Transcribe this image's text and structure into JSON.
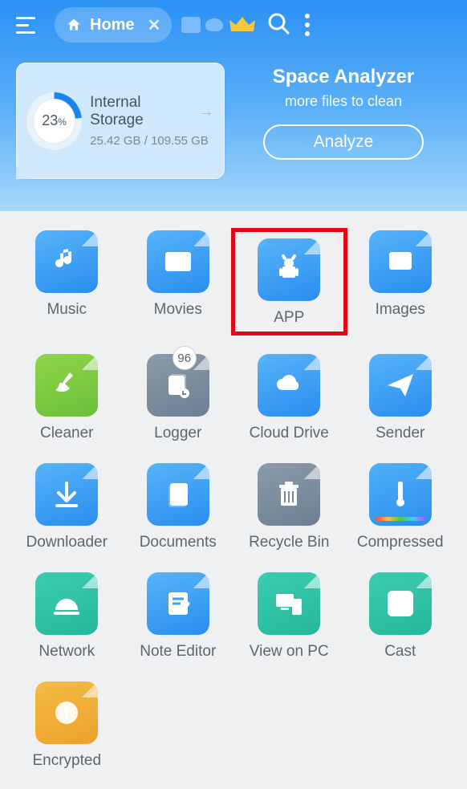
{
  "header": {
    "tab_label": "Home",
    "analyzer_title": "Space Analyzer",
    "analyzer_sub": "more files to clean",
    "analyze_btn": "Analyze"
  },
  "storage": {
    "title": "Internal Storage",
    "used": "25.42 GB",
    "total": "109.55 GB",
    "percent": 23,
    "percent_label": "23",
    "percent_unit": "%"
  },
  "grid": [
    {
      "id": "music",
      "label": "Music",
      "theme": "blue"
    },
    {
      "id": "movies",
      "label": "Movies",
      "theme": "blue"
    },
    {
      "id": "app",
      "label": "APP",
      "theme": "blue",
      "highlight": true
    },
    {
      "id": "images",
      "label": "Images",
      "theme": "blue"
    },
    {
      "id": "cleaner",
      "label": "Cleaner",
      "theme": "green"
    },
    {
      "id": "logger",
      "label": "Logger",
      "theme": "slate",
      "badge": "96"
    },
    {
      "id": "cloud-drive",
      "label": "Cloud Drive",
      "theme": "blue"
    },
    {
      "id": "sender",
      "label": "Sender",
      "theme": "blue"
    },
    {
      "id": "downloader",
      "label": "Downloader",
      "theme": "blue"
    },
    {
      "id": "documents",
      "label": "Documents",
      "theme": "blue"
    },
    {
      "id": "recycle-bin",
      "label": "Recycle Bin",
      "theme": "slate"
    },
    {
      "id": "compressed",
      "label": "Compressed",
      "theme": "rainbow"
    },
    {
      "id": "network",
      "label": "Network",
      "theme": "teal"
    },
    {
      "id": "note-editor",
      "label": "Note Editor",
      "theme": "blue"
    },
    {
      "id": "view-on-pc",
      "label": "View on PC",
      "theme": "teal"
    },
    {
      "id": "cast",
      "label": "Cast",
      "theme": "teal"
    },
    {
      "id": "encrypted",
      "label": "Encrypted",
      "theme": "orange"
    }
  ]
}
